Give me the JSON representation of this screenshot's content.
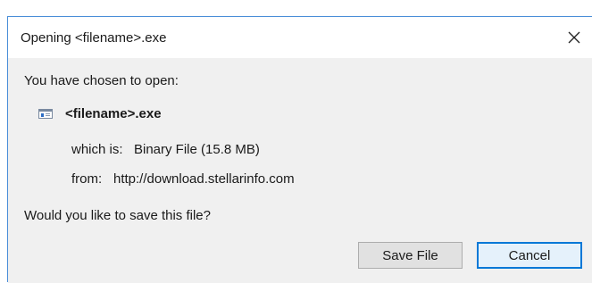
{
  "dialog": {
    "title_prefix": "Opening ",
    "title_filename": "<filename>.exe",
    "close_glyph": "×",
    "intro": "You have chosen to open:",
    "file_name": "<filename>.exe",
    "file_icon": "exe-file-icon",
    "type_label": "which is:",
    "type_value": "Binary File (15.8 MB)",
    "from_label": "from:",
    "from_value": "http://download.stellarinfo.com",
    "question": "Would you like to save this file?",
    "buttons": {
      "save": "Save File",
      "cancel": "Cancel"
    },
    "colors": {
      "accent": "#0078d7",
      "border": "#4a8ed8",
      "background": "#f0f0f0"
    }
  }
}
